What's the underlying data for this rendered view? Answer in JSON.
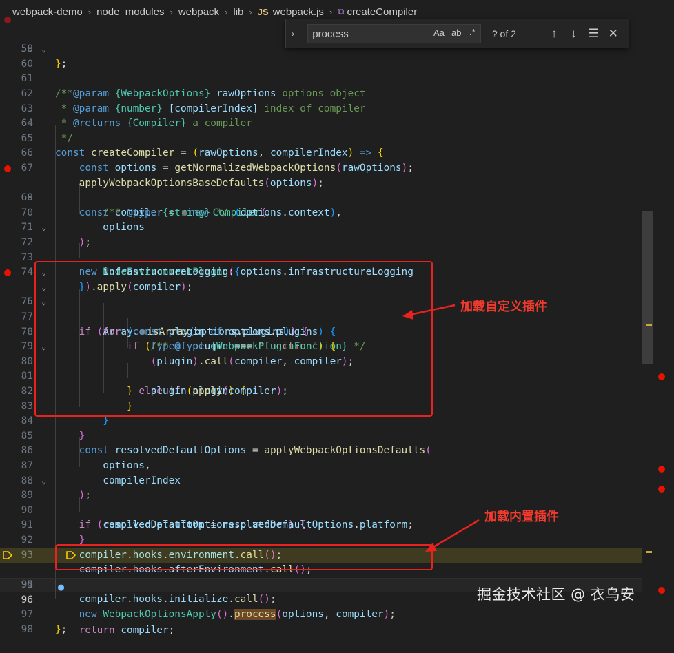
{
  "breadcrumb": {
    "items": [
      "webpack-demo",
      "node_modules",
      "webpack",
      "lib"
    ],
    "file_icon": "JS",
    "file": "webpack.js",
    "symbol": "createCompiler"
  },
  "find": {
    "value": "process",
    "opt_case": "Aa",
    "opt_word": "ab",
    "opt_regex": ".*",
    "count": "? of 2"
  },
  "annotations": {
    "custom_plugins": "加载自定义插件",
    "builtin_plugins": "加载内置插件"
  },
  "watermark": "掘金技术社区 @ 衣乌安",
  "colors": {
    "breakpoint": "#e51400",
    "annotation": "#e8231f",
    "keyword": "#569cd6",
    "variable": "#9cdcfe",
    "function": "#dcdcaa"
  },
  "code": [
    {
      "n": "58",
      "text": "};"
    },
    {
      "n": "59",
      "text": ""
    },
    {
      "n": "60",
      "text": "/**"
    },
    {
      "n": "61",
      "text": " * @param {WebpackOptions} rawOptions options object"
    },
    {
      "n": "62",
      "text": " * @param {number} [compilerIndex] index of compiler"
    },
    {
      "n": "63",
      "text": " * @returns {Compiler} a compiler"
    },
    {
      "n": "64",
      "text": " */"
    },
    {
      "n": "65",
      "text": "const createCompiler = (rawOptions, compilerIndex) => {"
    },
    {
      "n": "66",
      "text": "    const options = getNormalizedWebpackOptions(rawOptions);"
    },
    {
      "n": "67",
      "text": "    applyWebpackOptionsBaseDefaults(options);"
    },
    {
      "n": "68",
      "text": "    const compiler = new Compiler("
    },
    {
      "n": "69",
      "text": "        /** @type {string} */ (options.context),"
    },
    {
      "n": "70",
      "text": "        options"
    },
    {
      "n": "71",
      "text": "    );"
    },
    {
      "n": "72",
      "text": "    new NodeEnvironmentPlugin({"
    },
    {
      "n": "73",
      "text": "        infrastructureLogging: options.infrastructureLogging"
    },
    {
      "n": "74",
      "text": "    }).apply(compiler);"
    },
    {
      "n": "75",
      "text": "    if (Array.isArray(options.plugins)) {"
    },
    {
      "n": "76",
      "text": "        for (const plugin of options.plugins) {"
    },
    {
      "n": "77",
      "text": "            if (typeof plugin === \"function\") {"
    },
    {
      "n": "78",
      "text": "                /** @type {WebpackPluginFunction} */"
    },
    {
      "n": "79",
      "text": "                (plugin).call(compiler, compiler);"
    },
    {
      "n": "80",
      "text": "            } else if (plugin) {"
    },
    {
      "n": "81",
      "text": "                plugin.apply(compiler);"
    },
    {
      "n": "82",
      "text": "            }"
    },
    {
      "n": "83",
      "text": "        }"
    },
    {
      "n": "84",
      "text": "    }"
    },
    {
      "n": "85",
      "text": "    const resolvedDefaultOptions = applyWebpackOptionsDefaults("
    },
    {
      "n": "86",
      "text": "        options,"
    },
    {
      "n": "87",
      "text": "        compilerIndex"
    },
    {
      "n": "88",
      "text": "    );"
    },
    {
      "n": "89",
      "text": "    if (resolvedDefaultOptions.platform) {"
    },
    {
      "n": "90",
      "text": "        compiler.platform = resolvedDefaultOptions.platform;"
    },
    {
      "n": "91",
      "text": "    }"
    },
    {
      "n": "92",
      "text": "    compiler.hooks.environment.call();"
    },
    {
      "n": "93",
      "text": "    compiler.hooks.afterEnvironment.call();"
    },
    {
      "n": "94",
      "text": "    new WebpackOptionsApply().process(options, compiler);"
    },
    {
      "n": "95",
      "text": "    compiler.hooks.initialize.call();"
    },
    {
      "n": "96",
      "text": "    return compiler;"
    },
    {
      "n": "97",
      "text": "};"
    },
    {
      "n": "98",
      "text": ""
    }
  ]
}
